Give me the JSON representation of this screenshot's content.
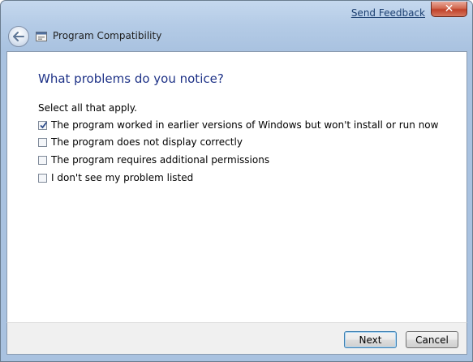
{
  "titlebar": {
    "feedback_link": "Send Feedback",
    "close_glyph": "✕",
    "window_title": "Program Compatibility"
  },
  "content": {
    "heading": "What problems do you notice?",
    "instruction": "Select all that apply.",
    "options": [
      {
        "label": "The program worked in earlier versions of Windows but won't install or run now",
        "checked": true
      },
      {
        "label": "The program does not display correctly",
        "checked": false
      },
      {
        "label": "The program requires additional permissions",
        "checked": false
      },
      {
        "label": "I don't see my problem listed",
        "checked": false
      }
    ]
  },
  "footer": {
    "next_label": "Next",
    "cancel_label": "Cancel"
  },
  "icons": {
    "back": "back-arrow-icon",
    "app": "program-compatibility-icon",
    "close": "close-icon",
    "check": "checkmark-icon"
  },
  "colors": {
    "heading": "#1e3287",
    "link": "#1a3e70",
    "close_button": "#c7472f"
  }
}
